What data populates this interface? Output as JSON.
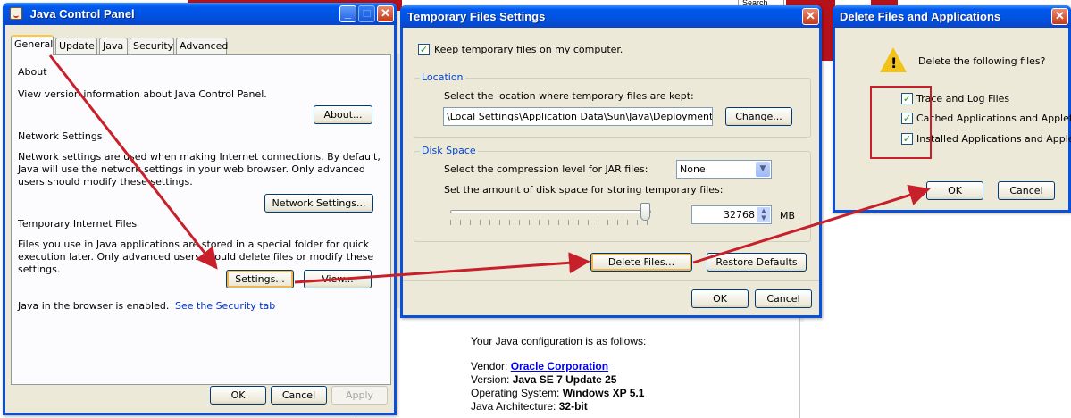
{
  "background": {
    "search_tab": "Search",
    "config_intro": "Your Java configuration is as follows:",
    "config": [
      {
        "label": "Vendor:",
        "value": "Oracle Corporation",
        "is_link": true
      },
      {
        "label": "Version:",
        "value": "Java SE 7 Update 25",
        "is_link": false
      },
      {
        "label": "Operating System:",
        "value": "Windows XP 5.1",
        "is_link": false
      },
      {
        "label": "Java Architecture:",
        "value": "32-bit",
        "is_link": false
      }
    ]
  },
  "control_panel": {
    "title": "Java Control Panel",
    "tabs": [
      "General",
      "Update",
      "Java",
      "Security",
      "Advanced"
    ],
    "active_tab": "General",
    "about_heading": "About",
    "about_text": "View version information about Java Control Panel.",
    "about_button": "About...",
    "network_heading": "Network Settings",
    "network_text": "Network settings are used when making Internet connections. By default, Java will use the network settings in your web browser. Only advanced users should modify these settings.",
    "network_button": "Network Settings...",
    "temp_heading": "Temporary Internet Files",
    "temp_text": "Files you use in Java applications are stored in a special folder for quick execution later. Only advanced users should delete files or modify these settings.",
    "settings_button": "Settings...",
    "view_button": "View...",
    "browser_status": "Java in the browser is enabled.",
    "security_link": "See the Security tab",
    "ok_button": "OK",
    "cancel_button": "Cancel",
    "apply_button": "Apply"
  },
  "temp_settings": {
    "title": "Temporary Files Settings",
    "keep_files_label": "Keep temporary files on my computer.",
    "keep_files_checked": true,
    "location_group": "Location",
    "location_text": "Select the location where temporary files are kept:",
    "location_path": "\\Local Settings\\Application Data\\Sun\\Java\\Deployment\\cache",
    "change_button": "Change...",
    "disk_group": "Disk Space",
    "compression_label": "Select the compression level for JAR files:",
    "compression_value": "None",
    "disk_label": "Set the amount of disk space for storing temporary files:",
    "disk_amount": "32768",
    "disk_unit": "MB",
    "slider_level": 0.97,
    "delete_button": "Delete Files...",
    "restore_button": "Restore Defaults",
    "ok_button": "OK",
    "cancel_button": "Cancel"
  },
  "delete_dialog": {
    "title": "Delete Files and Applications",
    "prompt": "Delete the following files?",
    "options": [
      {
        "label": "Trace and Log Files",
        "checked": true
      },
      {
        "label": "Cached Applications and Applets",
        "checked": true
      },
      {
        "label": "Installed Applications and Applets",
        "checked": true
      }
    ],
    "ok_button": "OK",
    "cancel_button": "Cancel"
  },
  "colors": {
    "xp_title_blue": "#0058ee",
    "annotation_red": "#c8202a",
    "link_blue": "#0033cc"
  }
}
